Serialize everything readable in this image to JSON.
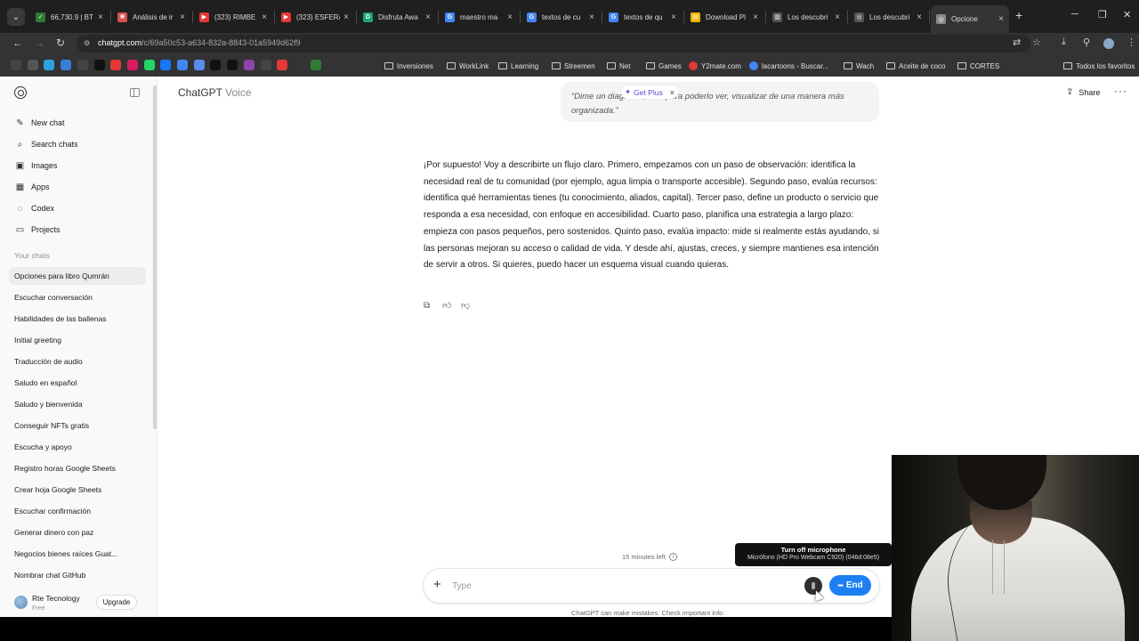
{
  "browser": {
    "tabs": [
      {
        "title": "66,730.9 | BT",
        "color": "#2e7d32",
        "glyph": "✓"
      },
      {
        "title": "Análisis de ir",
        "color": "#d9534f",
        "glyph": "✺"
      },
      {
        "title": "(323) RIMBE",
        "color": "#e53935",
        "glyph": "▶"
      },
      {
        "title": "(323) ESFER/",
        "color": "#e53935",
        "glyph": "▶"
      },
      {
        "title": "Disfruta Awa",
        "color": "#1aa37a",
        "glyph": "D"
      },
      {
        "title": "maestro ma",
        "color": "#4285f4",
        "glyph": "G"
      },
      {
        "title": "textos de cu",
        "color": "#4285f4",
        "glyph": "G"
      },
      {
        "title": "textos de qu",
        "color": "#4285f4",
        "glyph": "G"
      },
      {
        "title": "Download Pl",
        "color": "#f4b400",
        "glyph": "▤"
      },
      {
        "title": "Los descubri",
        "color": "#555555",
        "glyph": "▥"
      },
      {
        "title": "Los descubri",
        "color": "#555555",
        "glyph": "◎"
      },
      {
        "title": "Opcione",
        "color": "#888888",
        "glyph": "◎"
      }
    ],
    "url_host": "chatgpt.com",
    "url_path": "/c/69a50c53-a634-832a-8843-01a5949d62f9",
    "bookmark_icons": [
      {
        "icon": "grid-icon",
        "color": "#444444"
      },
      {
        "icon": "chatgpt-icon",
        "color": "#555555"
      },
      {
        "icon": "telegram-icon",
        "color": "#2aa3e0"
      },
      {
        "icon": "cloud-icon",
        "color": "#3b7dd8"
      },
      {
        "icon": "circle-icon",
        "color": "#444444"
      },
      {
        "icon": "x-icon",
        "color": "#111111"
      },
      {
        "icon": "youtube-icon",
        "color": "#e53935"
      },
      {
        "icon": "pinterest-icon",
        "color": "#d81b60"
      },
      {
        "icon": "whatsapp-icon",
        "color": "#25d366"
      },
      {
        "icon": "facebook-icon",
        "color": "#1877f2"
      },
      {
        "icon": "docs-icon",
        "color": "#4285f4"
      },
      {
        "icon": "sheets-icon",
        "color": "#5b8def"
      },
      {
        "icon": "imdb-icon",
        "color": "#111111"
      },
      {
        "icon": "tiktok-icon",
        "color": "#111111"
      },
      {
        "icon": "twitch-icon",
        "color": "#8e44ad"
      },
      {
        "icon": "chatgpt-icon",
        "color": "#444444"
      },
      {
        "icon": "heart-icon",
        "color": "#e53935"
      },
      {
        "icon": "bookmark-icon",
        "color": "#333333"
      },
      {
        "icon": "plus-icon",
        "color": "#2e7d32"
      }
    ],
    "bookmarks": [
      {
        "label": "Inversiones",
        "kind": "folder"
      },
      {
        "label": "WorkLink",
        "kind": "folder"
      },
      {
        "label": "Learning",
        "kind": "folder"
      },
      {
        "label": "Streemen",
        "kind": "folder"
      },
      {
        "label": "Net",
        "kind": "folder"
      },
      {
        "label": "Games",
        "kind": "folder"
      },
      {
        "label": "Y2mate.com",
        "kind": "site",
        "color": "#e53935"
      },
      {
        "label": "lacartoons - Buscar...",
        "kind": "site",
        "color": "#4285f4"
      },
      {
        "label": "Wach",
        "kind": "folder"
      },
      {
        "label": "Aceite de coco",
        "kind": "folder"
      },
      {
        "label": "CORTES",
        "kind": "folder"
      }
    ],
    "all_favorites_label": "Todos los favoritos"
  },
  "sidebar": {
    "nav": [
      {
        "label": "New chat",
        "icon": "edit-icon",
        "glyph": "✎"
      },
      {
        "label": "Search chats",
        "icon": "search-icon",
        "glyph": "⌕"
      },
      {
        "label": "Images",
        "icon": "image-icon",
        "glyph": "▣"
      },
      {
        "label": "Apps",
        "icon": "apps-icon",
        "glyph": "▦"
      },
      {
        "label": "Codex",
        "icon": "codex-icon",
        "glyph": "◌"
      },
      {
        "label": "Projects",
        "icon": "folder-icon",
        "glyph": "▭"
      }
    ],
    "section_heading": "Your chats",
    "chats": [
      "Opciones para libro Qumrán",
      "Escuchar conversación",
      "Habilidades de las ballenas",
      "Initial greeting",
      "Traducción de audio",
      "Saludo en español",
      "Saludo y bienvenida",
      "Conseguir NFTs gratis",
      "Escucha y apoyo",
      "Registro horas Google Sheets",
      "Crear hoja Google Sheets",
      "Escuchar confirmación",
      "Generar dinero con paz",
      "Negocios bienes raíces Guat...",
      "Nombrar chat GitHub"
    ],
    "user": {
      "name": "Rte Tecnology",
      "plan": "Free",
      "upgrade_label": "Upgrade"
    }
  },
  "header": {
    "brand": "ChatGPT",
    "mode": "Voice",
    "share_label": "Share"
  },
  "conversation": {
    "user_message": "“Dime un diagrama, solo para poderlo ver, visualizar de una manera más organizada.”",
    "get_plus_label": "Get Plus",
    "assistant_message": "¡Por supuesto! Voy a describirte un flujo claro. Primero, empezamos con un paso de observación: identifica la necesidad real de tu comunidad (por ejemplo, agua limpia o transporte accesible). Segundo paso, evalúa recursos: identifica qué herramientas tienes (tu conocimiento, aliados, capital). Tercer paso, define un producto o servicio que responda a esa necesidad, con enfoque en accesibilidad. Cuarto paso, planifica una estrategia a largo plazo: empieza con pasos pequeños, pero sostenidos. Quinto paso, evalúa impacto: mide si realmente estás ayudando, si las personas mejoran su acceso o calidad de vida. Y desde ahí, ajustas, creces, y siempre mantienes esa intención de servir a otros. Si quieres, puedo hacer un esquema visual cuando quieras."
  },
  "composer": {
    "minutes_left": "15 minutes left",
    "placeholder": "Type",
    "end_label": "End",
    "disclaimer": "ChatGPT can make mistakes. Check important info."
  },
  "tooltip": {
    "title": "Turn off microphone",
    "device": "Micrófono (HD Pro Webcam C920) (046d:08e5)"
  },
  "colors": {
    "accent": "#1d7ff2",
    "get_plus": "#5b46d6",
    "selected_chat_bg": "#ececec"
  }
}
